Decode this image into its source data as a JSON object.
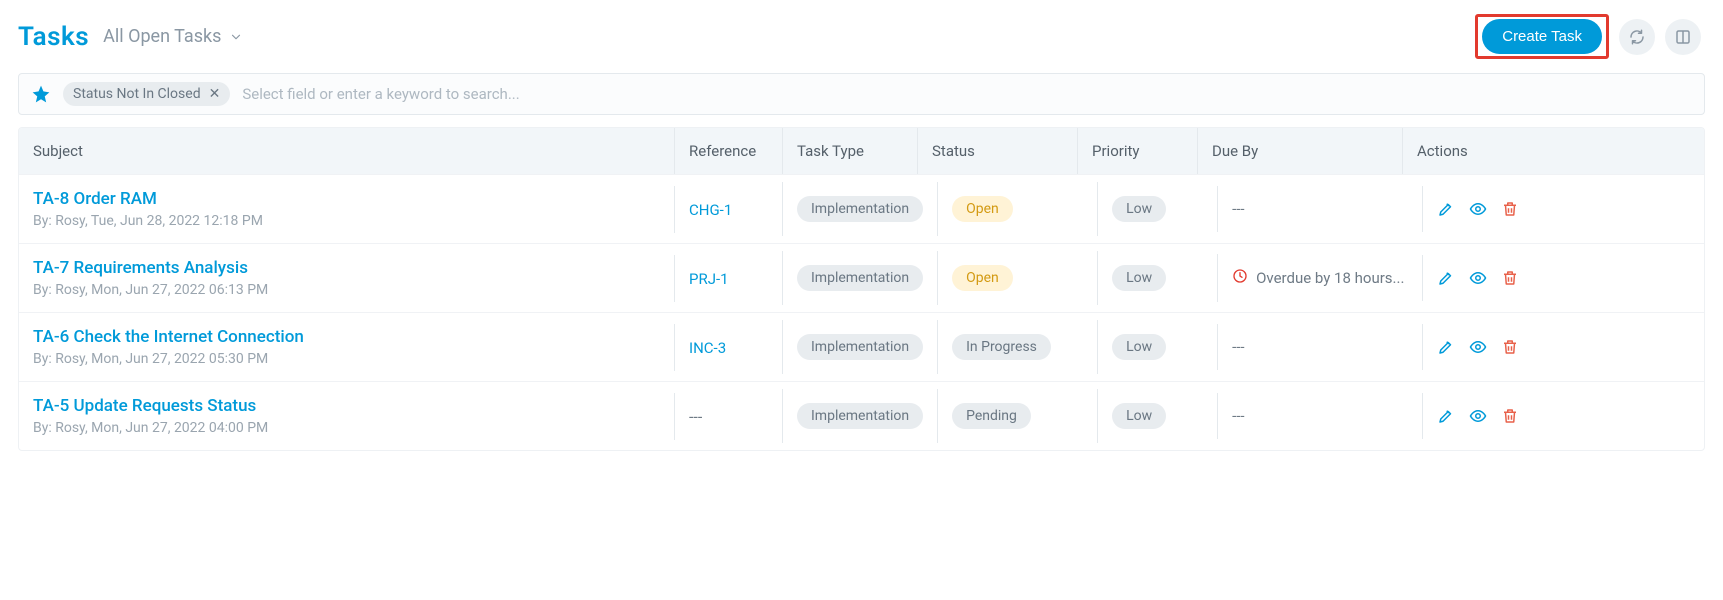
{
  "header": {
    "title": "Tasks",
    "filter_label": "All Open Tasks",
    "create_button": "Create Task"
  },
  "search": {
    "chip_label": "Status Not In Closed",
    "placeholder": "Select field or enter a keyword to search..."
  },
  "columns": {
    "subject": "Subject",
    "reference": "Reference",
    "task_type": "Task Type",
    "status": "Status",
    "priority": "Priority",
    "due_by": "Due By",
    "actions": "Actions"
  },
  "rows": [
    {
      "subject": "TA-8 Order RAM",
      "by": "By: Rosy, Tue, Jun 28, 2022 12:18 PM",
      "reference": "CHG-1",
      "task_type": "Implementation",
      "status": "Open",
      "status_class": "open",
      "priority": "Low",
      "due_by": "---",
      "overdue": false
    },
    {
      "subject": "TA-7 Requirements Analysis",
      "by": "By: Rosy, Mon, Jun 27, 2022 06:13 PM",
      "reference": "PRJ-1",
      "task_type": "Implementation",
      "status": "Open",
      "status_class": "open",
      "priority": "Low",
      "due_by": "Overdue by 18 hours...",
      "overdue": true
    },
    {
      "subject": "TA-6 Check the Internet Connection",
      "by": "By: Rosy, Mon, Jun 27, 2022 05:30 PM",
      "reference": "INC-3",
      "task_type": "Implementation",
      "status": "In Progress",
      "status_class": "inprog",
      "priority": "Low",
      "due_by": "---",
      "overdue": false
    },
    {
      "subject": "TA-5 Update Requests Status",
      "by": "By: Rosy, Mon, Jun 27, 2022 04:00 PM",
      "reference": "---",
      "task_type": "Implementation",
      "status": "Pending",
      "status_class": "pending",
      "priority": "Low",
      "due_by": "---",
      "overdue": false
    }
  ]
}
